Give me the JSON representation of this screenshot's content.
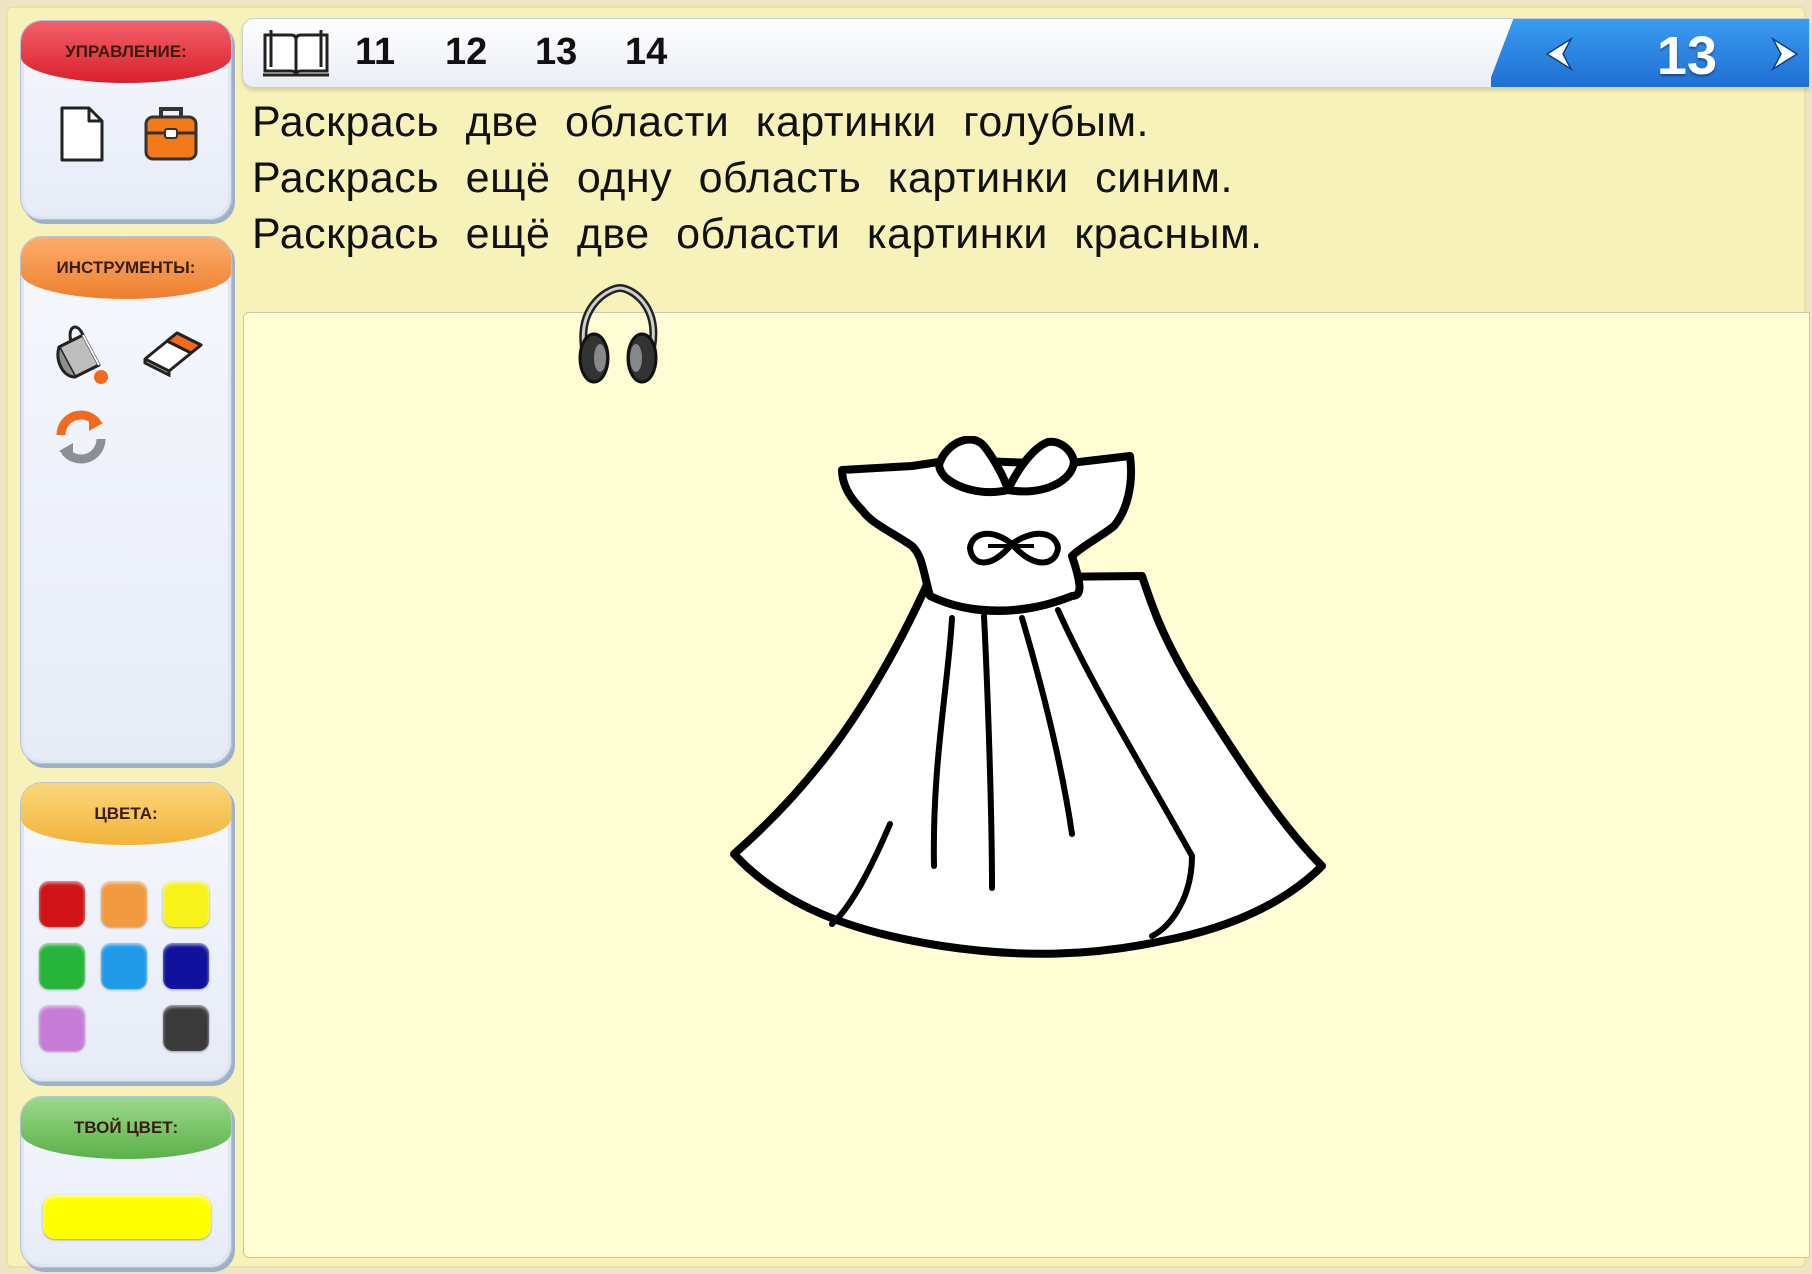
{
  "panels": {
    "control": {
      "title": "УПРАВЛЕНИЕ:",
      "icons": [
        "new-page-icon",
        "briefcase-icon"
      ]
    },
    "tools": {
      "title": "ИНСТРУМЕНТЫ:",
      "icons": [
        "paint-bucket-icon",
        "eraser-icon",
        "refresh-icon"
      ]
    },
    "colors": {
      "title": "ЦВЕТА:",
      "swatches": [
        "#d01418",
        "#f29a3f",
        "#f7f21a",
        "#26b43a",
        "#1e9ae8",
        "#10129e",
        "#c77cd8",
        "#3a3a3a"
      ]
    },
    "my_color": {
      "title": "ТВОЙ ЦВЕТ:",
      "color": "#ffff00"
    }
  },
  "topbar": {
    "pages": [
      "11",
      "12",
      "13",
      "14"
    ],
    "current_page": "13",
    "icons": [
      "book-icon",
      "prev-arrow-icon",
      "next-arrow-icon"
    ]
  },
  "instructions": [
    "Раскрась две области картинки голубым.",
    "Раскрась ещё одну область картинки синим.",
    "Раскрась ещё две области картинки красным."
  ],
  "canvas": {
    "picture": "dress",
    "icons": [
      "headphones-icon"
    ]
  }
}
